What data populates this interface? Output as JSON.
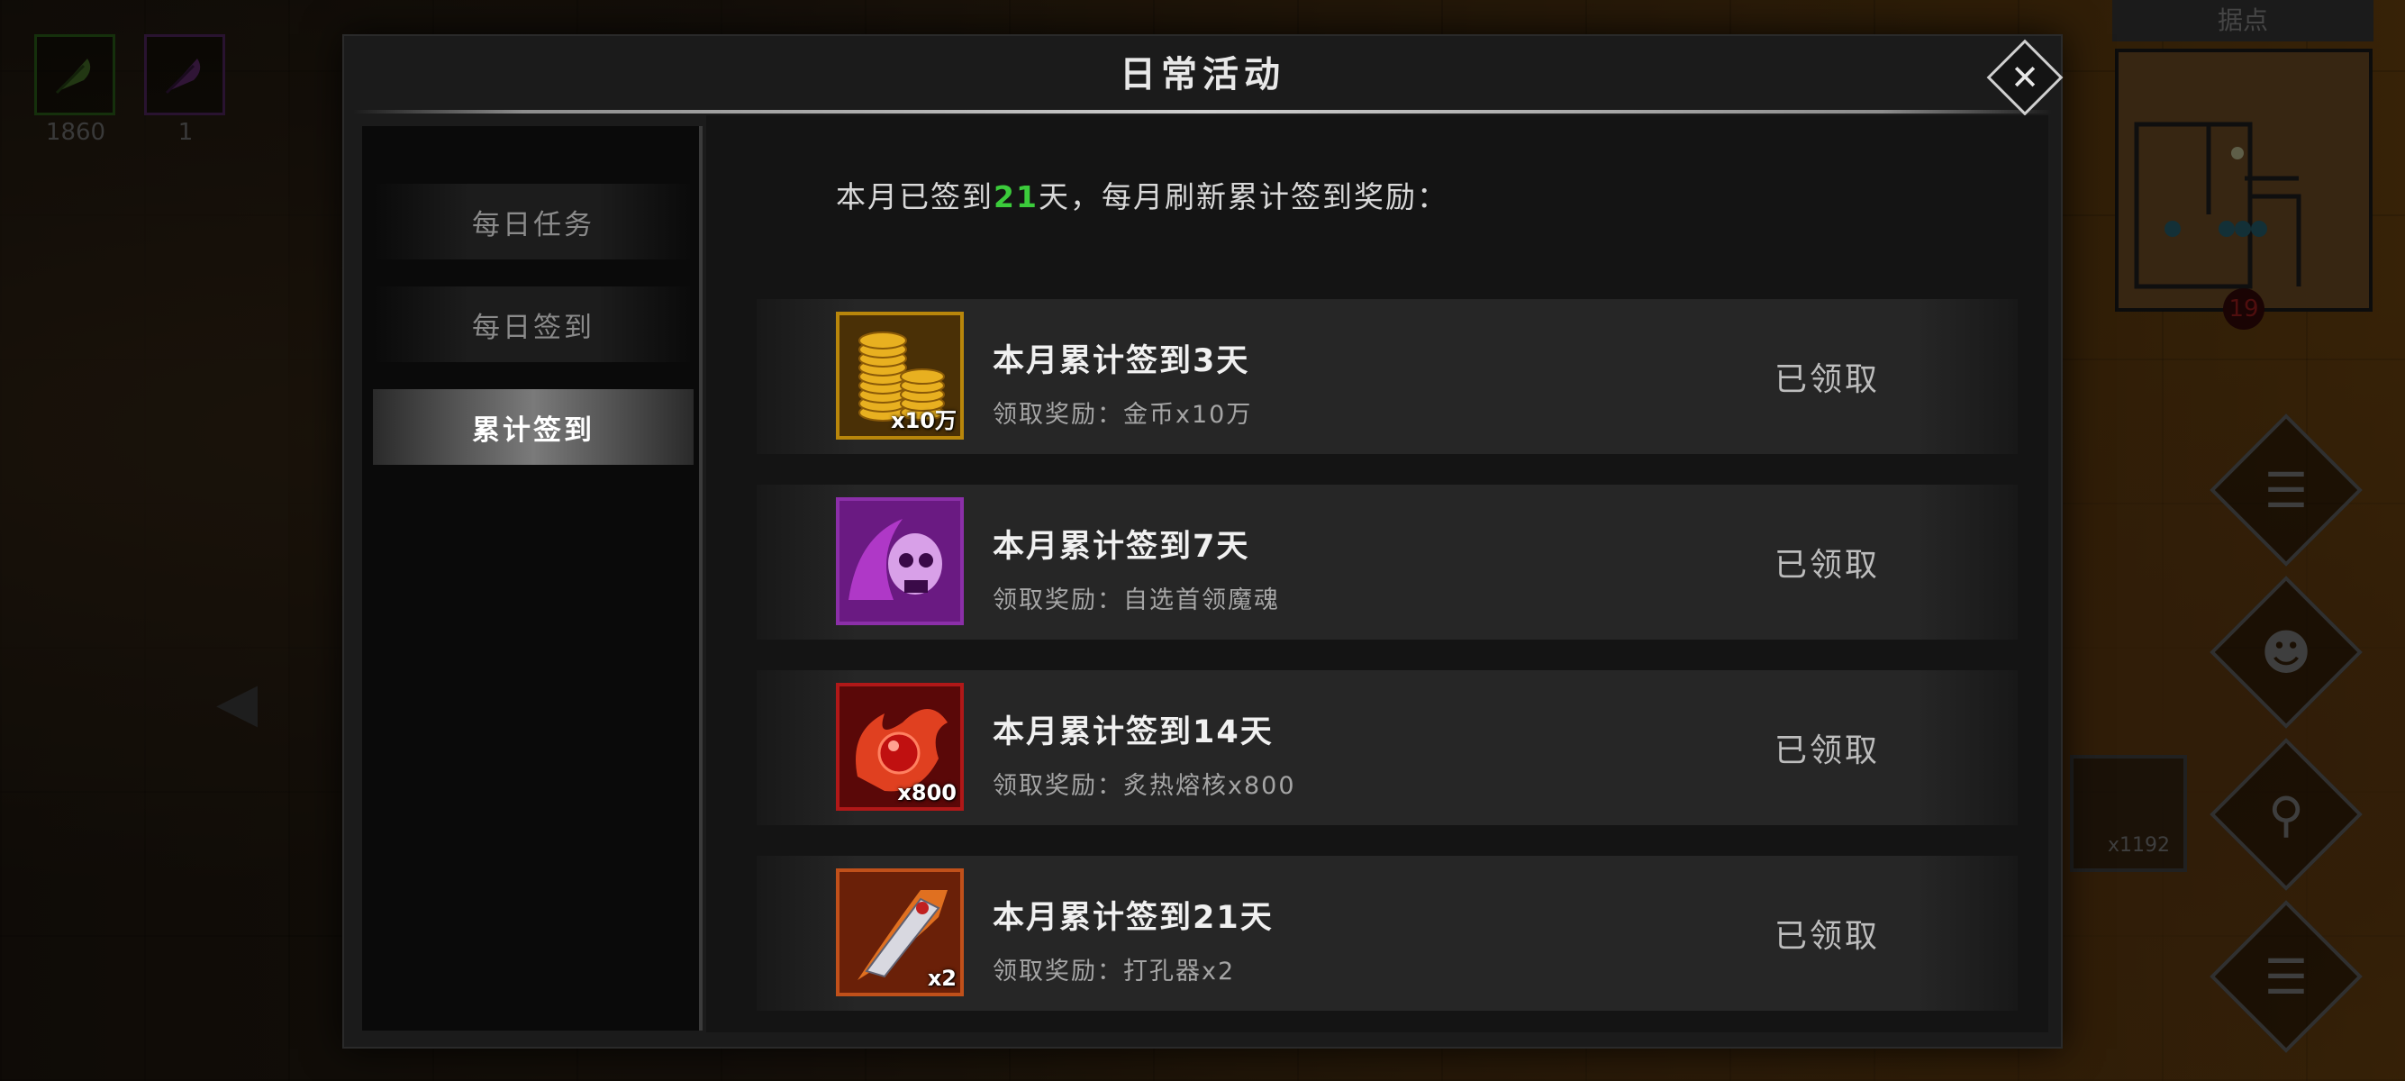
{
  "hud": {
    "resource_green_count": "1860",
    "resource_purple_count": "1",
    "minimap_title": "据点",
    "minimap_badge": "19",
    "potion_count": "x1192"
  },
  "modal": {
    "title": "日常活动",
    "tabs": [
      {
        "label": "每日任务",
        "active": false
      },
      {
        "label": "每日签到",
        "active": false
      },
      {
        "label": "累计签到",
        "active": true
      }
    ],
    "header": {
      "prefix": "本月已签到",
      "days": "21",
      "suffix": "天，每月刷新累计签到奖励："
    },
    "rewards": [
      {
        "title": "本月累计签到3天",
        "desc": "领取奖励：金币x10万",
        "badge": "x10万",
        "status": "已领取",
        "icon": "gold-coins-icon",
        "frame_color": "#b8860b"
      },
      {
        "title": "本月累计签到7天",
        "desc": "领取奖励：自选首领魔魂",
        "badge": "",
        "status": "已领取",
        "icon": "purple-skull-soul-icon",
        "frame_color": "#8b2fa8"
      },
      {
        "title": "本月累计签到14天",
        "desc": "领取奖励：炙热熔核x800",
        "badge": "x800",
        "status": "已领取",
        "icon": "fire-core-icon",
        "frame_color": "#b01818"
      },
      {
        "title": "本月累计签到21天",
        "desc": "领取奖励：打孔器x2",
        "badge": "x2",
        "status": "已领取",
        "icon": "drill-gem-icon",
        "frame_color": "#c0501a"
      }
    ]
  }
}
